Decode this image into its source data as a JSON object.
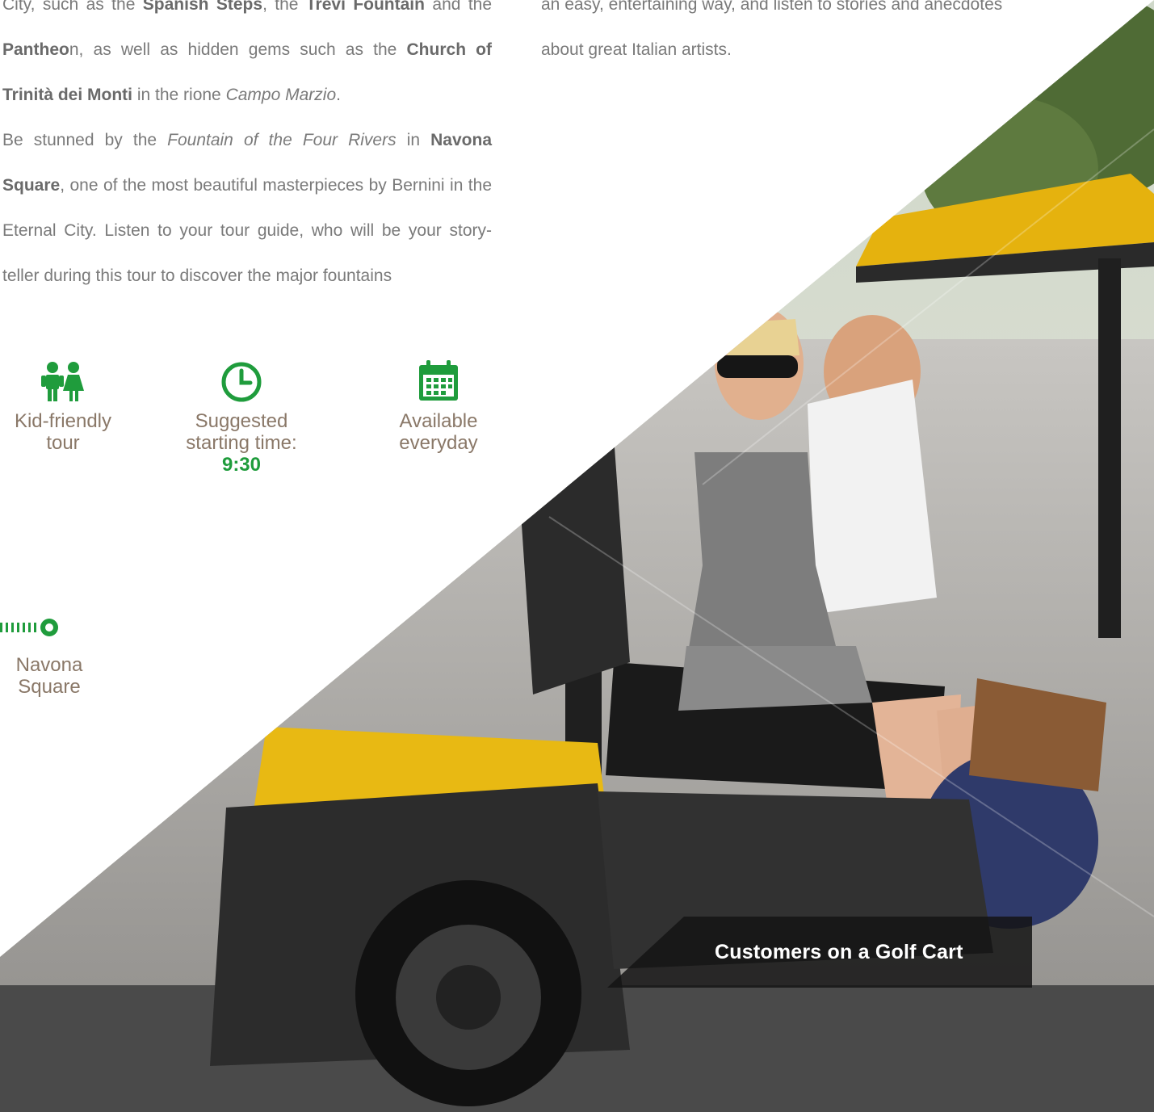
{
  "left_text": {
    "l1_a": "City, such as the ",
    "l1_b": "Spanish Steps",
    "l1_c": ", the ",
    "l1_d": "Trevi Fountain",
    "l1_e": " and the ",
    "l2_a": "Pantheo",
    "l2_b": "n, as well as hidden gems such as the ",
    "l2_c": "Church of",
    "l3_a": "Trinità dei Monti",
    "l3_b": " in the rione ",
    "l3_c": "Campo Marzio",
    "l3_d": ".",
    "p2_a": "Be stunned by the ",
    "p2_b": "Fountain of the Four Rivers",
    "p2_c": " in ",
    "p2_d": "Navona Square",
    "p2_e": ", one of the most beautiful masterpieces by Bernini in the Eternal City. Listen to your tour guide, who will be your story-teller during this tour to discover the major fountains"
  },
  "right_text": {
    "line1": "an easy, entertaining way, and listen to stories and anecdotes",
    "line2": "about great Italian artists."
  },
  "features": [
    {
      "icon": "kids-icon",
      "line1": "Kid-friendly",
      "line2": "tour"
    },
    {
      "icon": "clock-icon",
      "line1": "Suggested",
      "line2": "starting time:",
      "strong": "9:30"
    },
    {
      "icon": "calendar-icon",
      "line1": "Available",
      "line2": "everyday"
    }
  ],
  "route": {
    "stop_label_1": "Navona",
    "stop_label_2": "Square"
  },
  "caption": "Customers on a Golf Cart",
  "colors": {
    "accent_green": "#1f9c3c",
    "caption_bg": "#141414",
    "label_brown": "#8a7868"
  }
}
